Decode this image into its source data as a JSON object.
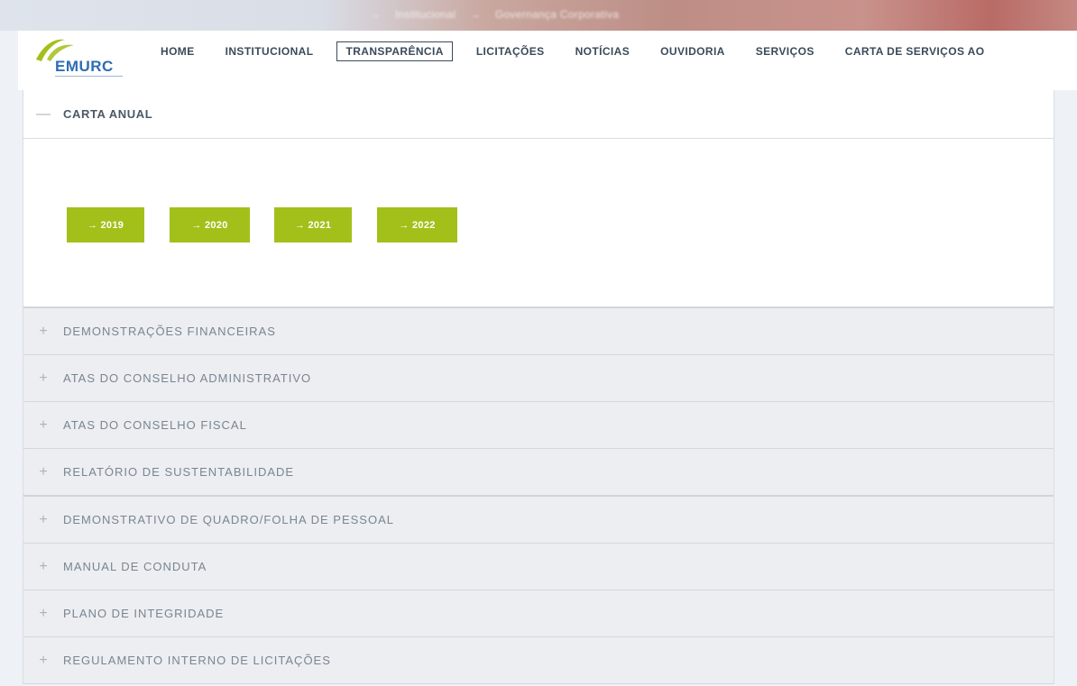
{
  "hero": {
    "breadcrumbs": [
      "→",
      "Institucional",
      "→",
      "Governança Corporativa"
    ]
  },
  "logo": {
    "text": "EMURC",
    "colors": {
      "green": "#a3c01a",
      "blue": "#2d6db3"
    }
  },
  "nav": {
    "items": [
      {
        "label": "HOME"
      },
      {
        "label": "INSTITUCIONAL"
      },
      {
        "label": "TRANSPARÊNCIA",
        "active": true
      },
      {
        "label": "LICITAÇÕES"
      },
      {
        "label": "NOTÍCIAS"
      },
      {
        "label": "OUVIDORIA"
      },
      {
        "label": "SERVIÇOS"
      },
      {
        "label": "CARTA DE SERVIÇOS AO"
      }
    ]
  },
  "accordion": {
    "open_section": {
      "sign": "—",
      "title": "CARTA ANUAL",
      "buttons": [
        {
          "label": "→ 2019"
        },
        {
          "label": "→ 2020"
        },
        {
          "label": "→ 2021"
        },
        {
          "label": "→ 2022"
        }
      ]
    },
    "sections": [
      {
        "sign": "+",
        "title": "DEMONSTRAÇÕES FINANCEIRAS"
      },
      {
        "sign": "+",
        "title": "ATAS DO CONSELHO ADMINISTRATIVO"
      },
      {
        "sign": "+",
        "title": "ATAS DO CONSELHO FISCAL"
      },
      {
        "sign": "+",
        "title": "RELATÓRIO DE SUSTENTABILIDADE"
      },
      {
        "sign": "+",
        "title": "DEMONSTRATIVO DE QUADRO/FOLHA DE PESSOAL"
      },
      {
        "sign": "+",
        "title": "MANUAL DE CONDUTA"
      },
      {
        "sign": "+",
        "title": "PLANO DE INTEGRIDADE"
      },
      {
        "sign": "+",
        "title": "REGULAMENTO INTERNO DE LICITAÇÕES"
      }
    ]
  },
  "colors": {
    "accent_green": "#a3c01a",
    "page_bg": "#eef1f6",
    "row_bg": "#eceef1",
    "nav_text": "#3b4a5a"
  }
}
